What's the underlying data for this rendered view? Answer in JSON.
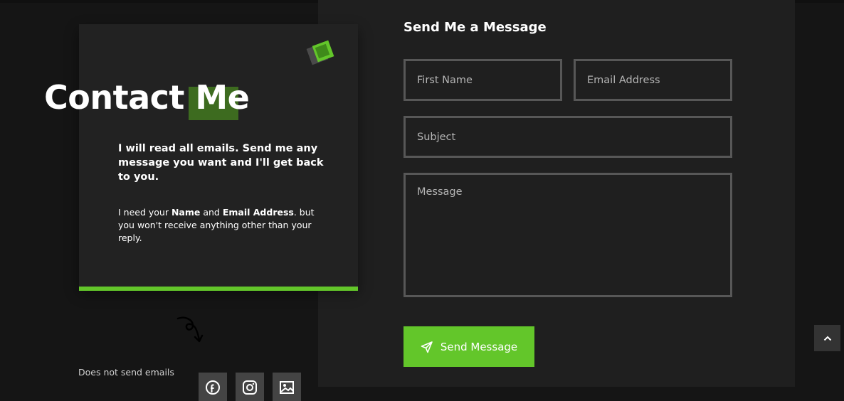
{
  "contact": {
    "title": "Contact Me",
    "intro": "I will read all emails. Send me any message you want and I'll get back to you.",
    "detail": {
      "prefix": "I need your ",
      "name_label": "Name",
      "joiner": " and ",
      "email_label": "Email Address",
      "suffix": ". but you won't receive anything other than your reply."
    },
    "disclaimer": "Does not send emails",
    "social": [
      "facebook-icon",
      "instagram-icon",
      "image-icon"
    ]
  },
  "form": {
    "title": "Send Me a Message",
    "first_name_placeholder": "First Name",
    "email_placeholder": "Email Address",
    "subject_placeholder": "Subject",
    "message_placeholder": "Message",
    "submit_label": "Send Message"
  },
  "colors": {
    "accent": "#63c62a",
    "background": "#151515",
    "panel": "#1f1f1f",
    "card": "#222222",
    "field_border": "#575757"
  }
}
